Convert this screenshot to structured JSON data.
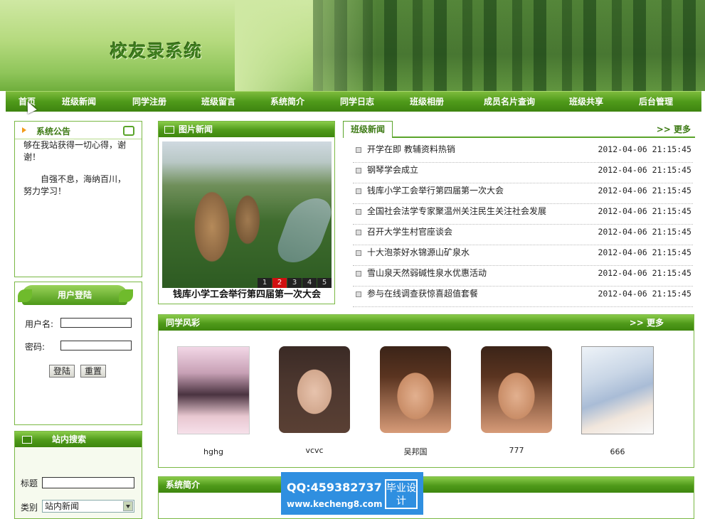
{
  "header": {
    "title": "校友录系统"
  },
  "nav": [
    "首页",
    "班级新闻",
    "同学注册",
    "班级留言",
    "系统简介",
    "同学日志",
    "班级相册",
    "成员名片查询",
    "班级共享",
    "后台管理"
  ],
  "notice": {
    "title": "系统公告",
    "lines": [
      "够在我站获得一切心得，谢谢！",
      "自强不息，海纳百川，努力学习！"
    ]
  },
  "login": {
    "title": "用户登陆",
    "username_label": "用户名:",
    "password_label": "密码:",
    "login_button": "登陆",
    "reset_button": "重置"
  },
  "search": {
    "title": "站内搜索",
    "title_label": "标题",
    "category_label": "类别",
    "category_value": "站内新闻"
  },
  "picture_news": {
    "title": "图片新闻",
    "caption": "钱库小学工会举行第四届第一次大会",
    "pages": [
      "1",
      "2",
      "3",
      "4",
      "5"
    ],
    "active_page": "2"
  },
  "class_news": {
    "tab": "班级新闻",
    "more": ">> 更多",
    "items": [
      {
        "title": "开学在即  教辅资料热销",
        "date": "2012-04-06 21:15:45"
      },
      {
        "title": "钢琴学会成立",
        "date": "2012-04-06 21:15:45"
      },
      {
        "title": "钱库小学工会举行第四届第一次大会",
        "date": "2012-04-06 21:15:45"
      },
      {
        "title": "全国社会法学专家聚温州关注民生关注社会发展",
        "date": "2012-04-06 21:15:45"
      },
      {
        "title": "召开大学生村官座谈会",
        "date": "2012-04-06 21:15:45"
      },
      {
        "title": "十大泡茶好水锦源山矿泉水",
        "date": "2012-04-06 21:15:45"
      },
      {
        "title": "雪山泉天然弱碱性泉水优惠活动",
        "date": "2012-04-06 21:15:45"
      },
      {
        "title": "参与在线调查获惊喜超值套餐",
        "date": "2012-04-06 21:15:45"
      }
    ]
  },
  "classmates": {
    "title": "同学风彩",
    "more": ">> 更多",
    "members": [
      {
        "name": "hghg",
        "pic": "poster-cover-image"
      },
      {
        "name": "vcvc",
        "pic": "woman-portrait"
      },
      {
        "name": "吴邦国",
        "pic": "man-portrait"
      },
      {
        "name": "777",
        "pic": "man-portrait"
      },
      {
        "name": "666",
        "pic": "anime-portrait"
      }
    ]
  },
  "intro": {
    "title": "系统简介"
  },
  "watermark": {
    "qq": "QQ:459382737",
    "url": "www.kecheng8.com",
    "badge": "毕业设计"
  }
}
